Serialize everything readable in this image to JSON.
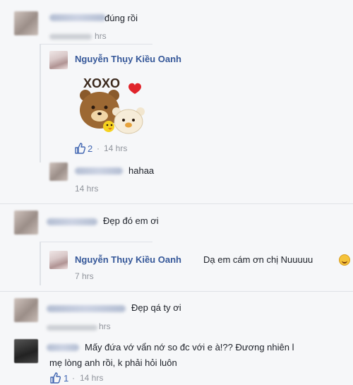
{
  "comments": [
    {
      "text": "đúng rồi",
      "time": "hrs"
    },
    {
      "author": "Nguyễn Thụy Kiều Oanh",
      "like_count": "2",
      "time": "14 hrs",
      "sticker_text": "XOXO"
    },
    {
      "text": "hahaa",
      "time": "14 hrs"
    },
    {
      "text": "Đẹp đó em ơi"
    },
    {
      "author": "Nguyễn Thụy Kiều Oanh",
      "text": "Dạ em cám ơn chị Nuuuuu",
      "time": "7 hrs"
    },
    {
      "text": "Đẹp qá ty ơi",
      "time": "hrs"
    },
    {
      "text_line1": "Mấy đứa vớ vẩn nớ so đc với e à!?? Đương nhiên l",
      "text_line2": "mẹ lòng anh rồi, k phải hỏi luôn",
      "like_count": "1",
      "time": "14 hrs"
    }
  ],
  "separator": "·",
  "icons": {
    "like": "thumbs-up-icon",
    "emoji": "smile-emoji-icon",
    "heart": "heart-icon"
  },
  "colors": {
    "link": "#365899",
    "meta": "#90949c",
    "like": "#4267b2"
  }
}
